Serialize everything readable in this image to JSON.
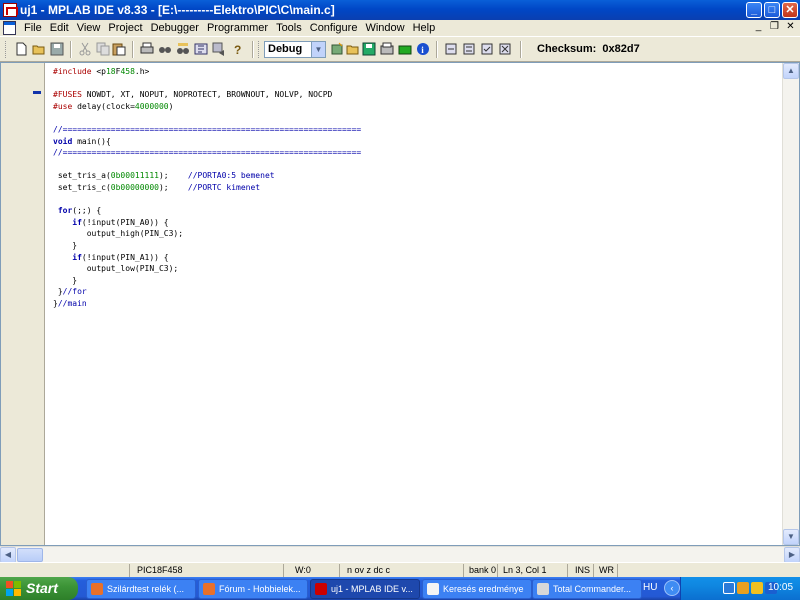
{
  "window": {
    "title": "uj1 - MPLAB IDE v8.33 - [E:\\---------Elektro\\PIC\\C\\main.c]",
    "minimize": "_",
    "maximize": "□",
    "close": "✕"
  },
  "menu": {
    "items": [
      "File",
      "Edit",
      "View",
      "Project",
      "Debugger",
      "Programmer",
      "Tools",
      "Configure",
      "Window",
      "Help"
    ],
    "doc_minimize": "_",
    "doc_restore": "❐",
    "doc_close": "✕"
  },
  "toolbar": {
    "build_config": "Debug",
    "checksum_label": "Checksum:",
    "checksum_value": "0x82d7",
    "icons": [
      "new-file-icon",
      "open-file-icon",
      "save-icon",
      "cut-icon",
      "copy-icon",
      "paste-icon",
      "print-icon",
      "find-icon",
      "find-in-files-icon",
      "bookmark-icon",
      "help-icon",
      "new-project-icon",
      "open-project-icon",
      "save-project-icon",
      "build-icon",
      "make-icon",
      "build-all-icon",
      "info-icon",
      "program-icon",
      "read-icon",
      "verify-icon",
      "erase-icon"
    ]
  },
  "code": {
    "lines": [
      "#include <p18F458.h>",
      "",
      "#FUSES NOWDT, XT, NOPUT, NOPROTECT, BROWNOUT, NOLVP, NOCPD",
      "#use delay(clock=4000000)",
      "",
      "//==============================================================",
      "void main(){",
      "//==============================================================",
      "",
      " set_tris_a(0b00011111);    //PORTA0:5 bemenet",
      " set_tris_c(0b00000000);    //PORTC kimenet",
      "",
      " for(;;) {",
      "    if(!input(PIN_A0)) {",
      "       output_high(PIN_C3);",
      "    }",
      "    if(!input(PIN_A1)) {",
      "       output_low(PIN_C3);",
      "    }",
      " }//for",
      "}//main"
    ]
  },
  "status": {
    "device": "PIC18F458",
    "wreg": "W:0",
    "flags": "n ov z dc c",
    "bank": "bank 0",
    "position": "Ln 3, Col 1",
    "ins": "INS",
    "wr": "WR"
  },
  "taskbar": {
    "start": "Start",
    "tasks": [
      {
        "label": "Szilárdtest relék (..."
      },
      {
        "label": "Fórum - Hobbielek..."
      },
      {
        "label": "uj1 - MPLAB IDE v..."
      },
      {
        "label": "Keresés eredménye"
      },
      {
        "label": "Total Commander..."
      }
    ],
    "lang": "HU",
    "clock": "10:05"
  },
  "colors": {
    "keyword": "#0000aa",
    "preprocessor": "#aa0000",
    "number": "#008800",
    "titlebar": "#0047c6",
    "taskbar": "#245edb"
  }
}
